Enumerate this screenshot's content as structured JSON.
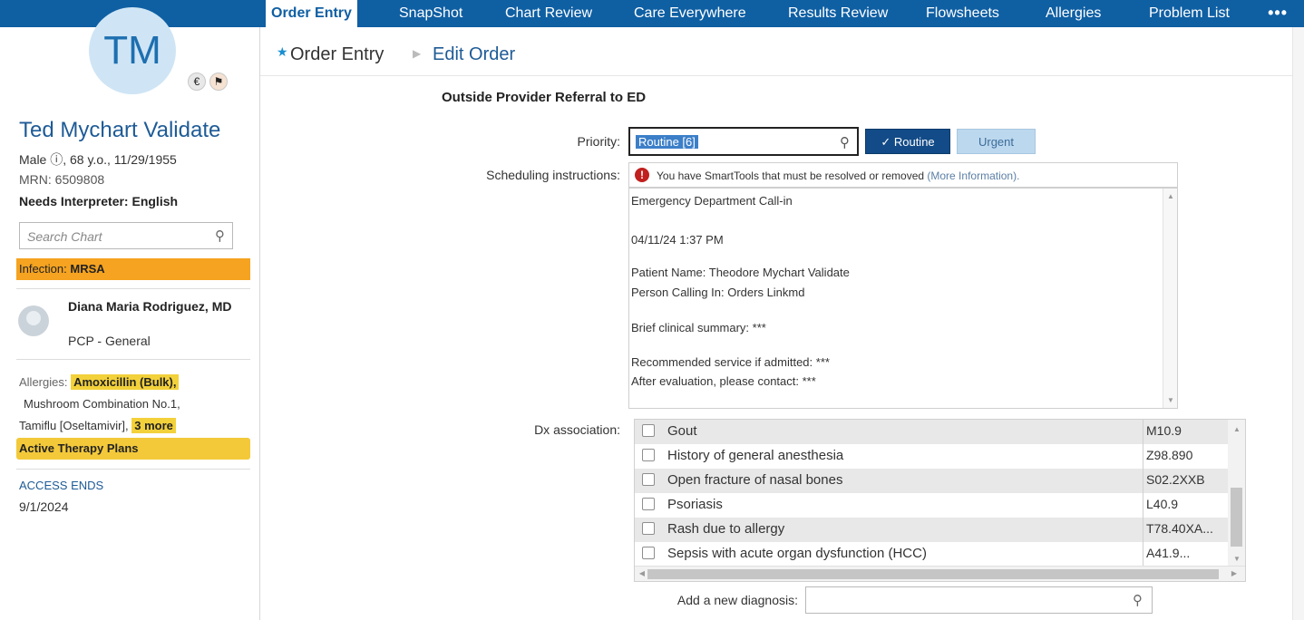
{
  "patient": {
    "initials": "TM",
    "name": "Ted Mychart Validate",
    "demographics": "Male ⓘ, 68 y.o., 11/29/1955",
    "mrn": "MRN: 6509808",
    "interpreter": "Needs Interpreter: English",
    "search_placeholder": "Search Chart",
    "infection_label": "Infection: ",
    "infection_value": "MRSA",
    "pcp_name": "Diana Maria Rodriguez, MD",
    "pcp_role": "PCP - General",
    "allergies_label": "Allergies: ",
    "allergy_1": "Amoxicillin (Bulk),",
    "allergy_2": "Mushroom Combination No.1,",
    "allergy_3": "Tamiflu [Oseltamivir],",
    "allergy_more": "3 more",
    "therapy_plans": "Active Therapy Plans",
    "access_label": "ACCESS ENDS",
    "access_date": "9/1/2024"
  },
  "tabs": [
    {
      "label": "Order Entry",
      "active": true
    },
    {
      "label": "SnapShot"
    },
    {
      "label": "Chart Review"
    },
    {
      "label": "Care Everywhere"
    },
    {
      "label": "Results Review"
    },
    {
      "label": "Flowsheets"
    },
    {
      "label": "Allergies"
    },
    {
      "label": "Problem List"
    }
  ],
  "tab_more": "•••",
  "breadcrumb": {
    "root": "Order Entry",
    "current": "Edit Order"
  },
  "form": {
    "title": "Outside Provider Referral to ED",
    "priority_label": "Priority:",
    "priority_value": "Routine [6]",
    "routine_label": "✓ Routine",
    "urgent_label": "Urgent",
    "sched_label": "Scheduling instructions:",
    "warning_text": "You have SmartTools that must be resolved or removed ",
    "warning_link": "(More Information).",
    "notes": [
      "Emergency Department Call-in",
      "04/11/24 1:37 PM",
      "Patient Name: Theodore Mychart Validate",
      "Person Calling In:    Orders Linkmd",
      "Brief clinical summary: ***",
      "Recommended service if admitted: ***",
      "After evaluation, please contact: ***"
    ],
    "dx_label": "Dx association:",
    "dx_rows": [
      {
        "name": "Gout",
        "code": "M10.9"
      },
      {
        "name": "History of general anesthesia",
        "code": "Z98.890"
      },
      {
        "name": "Open fracture of nasal bones",
        "code": "S02.2XXB"
      },
      {
        "name": "Psoriasis",
        "code": "L40.9"
      },
      {
        "name": "Rash due to allergy",
        "code": "T78.40XA..."
      },
      {
        "name": "Sepsis with acute organ dysfunction (HCC)",
        "code": "A41.9..."
      }
    ],
    "new_dx_label": "Add a new diagnosis:",
    "new_dx_value": ""
  },
  "colors": {
    "brand": "#0f5fa3",
    "infection": "#f5a320",
    "highlight": "#f3d13a",
    "routine_btn": "#124b87",
    "urgent_btn": "#bcd8ee",
    "warning": "#c0201e"
  },
  "icons": {
    "search": "magnifier-icon",
    "warning": "exclamation-circle-icon",
    "star": "star-icon"
  }
}
